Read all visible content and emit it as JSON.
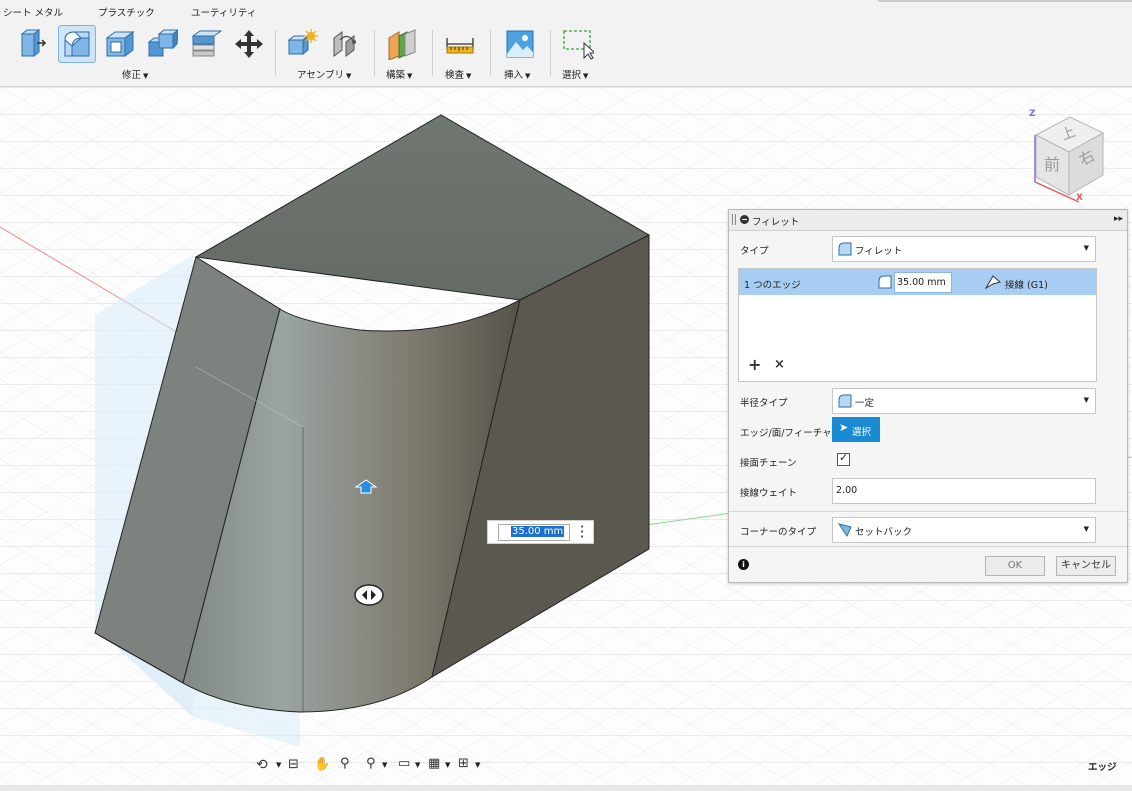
{
  "toolbar": {
    "tabs": [
      "シート メタル",
      "プラスチック",
      "ユーティリティ"
    ],
    "groups": {
      "modify": "修正",
      "assemble": "アセンブリ",
      "construct": "構築",
      "inspect": "検査",
      "insert": "挿入",
      "select": "選択"
    },
    "icons": [
      "press-pull-icon",
      "fillet-icon",
      "shell-icon",
      "combine-icon",
      "offset-face-icon",
      "move-icon",
      "new-component-icon",
      "joint-icon",
      "offset-plane-icon",
      "measure-icon",
      "insert-image-icon",
      "select-window-icon"
    ]
  },
  "viewport": {
    "dimension_value": "35.00 mm",
    "viewcube": {
      "top": "上",
      "front": "前",
      "right": "右",
      "axis_z": "Z",
      "axis_x": "X"
    },
    "status_text": "エッジ",
    "nav_icons": [
      "orbit-icon",
      "look-at-icon",
      "pan-icon",
      "zoom-icon",
      "fit-icon",
      "display-settings-icon",
      "grid-icon",
      "viewports-icon"
    ]
  },
  "fillet_panel": {
    "title": "フィレット",
    "type_label": "タイプ",
    "type_value": "フィレット",
    "edge_row": {
      "name": "1 つのエッジ",
      "radius": "35.00 mm",
      "continuity": "接線 (G1)"
    },
    "add_label": "+",
    "remove_label": "×",
    "radius_type_label": "半径タイプ",
    "radius_type_value": "一定",
    "edge_face_label": "エッジ/面/フィーチャ",
    "select_button": "選択",
    "tangent_chain_label": "接面チェーン",
    "tangent_chain_checked": true,
    "tangent_weight_label": "接線ウェイト",
    "tangent_weight_value": "2.00",
    "corner_type_label": "コーナーのタイプ",
    "corner_type_value": "セットバック",
    "ok": "OK",
    "cancel": "キャンセル",
    "colors": {
      "selection": "#a8cdf2",
      "accent": "#1a8ad4"
    }
  }
}
